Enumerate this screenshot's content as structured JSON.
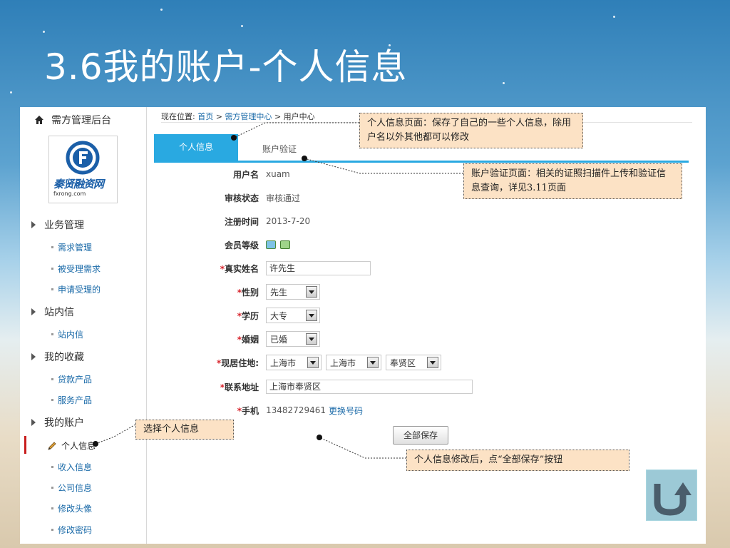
{
  "slide": {
    "title": "3.6我的账户-个人信息"
  },
  "sidebar": {
    "header": "需方管理后台",
    "logo_text": "秦贤融资网",
    "logo_subtext": "fxrong.com",
    "groups": [
      {
        "label": "业务管理",
        "items": [
          "需求管理",
          "被受理需求",
          "申请受理的"
        ]
      },
      {
        "label": "站内信",
        "items": [
          "站内信"
        ]
      },
      {
        "label": "我的收藏",
        "items": [
          "贷款产品",
          "服务产品"
        ]
      },
      {
        "label": "我的账户",
        "items": [
          "个人信息",
          "收入信息",
          "公司信息",
          "修改头像",
          "修改密码"
        ]
      }
    ],
    "active_item": "个人信息"
  },
  "breadcrumb": {
    "prefix": "现在位置:",
    "home": "首页",
    "sep1": ">",
    "center": "需方管理中心",
    "sep2": ">",
    "current": "用户中心"
  },
  "tabs": {
    "active": "个人信息",
    "inactive": "账户验证"
  },
  "form": {
    "username": {
      "label": "用户名",
      "value": "xuam"
    },
    "review_status": {
      "label": "审核状态",
      "value": "审核通过"
    },
    "register_time": {
      "label": "注册时间",
      "value": "2013-7-20"
    },
    "member_level": {
      "label": "会员等级"
    },
    "real_name": {
      "required": "*",
      "label": "真实姓名",
      "value": "许先生"
    },
    "gender": {
      "required": "*",
      "label": "性别",
      "value": "先生"
    },
    "education": {
      "required": "*",
      "label": "学历",
      "value": "大专"
    },
    "marriage": {
      "required": "*",
      "label": "婚姻",
      "value": "已婚"
    },
    "residence": {
      "required": "*",
      "label": "现居住地:",
      "province": "上海市",
      "city": "上海市",
      "district": "奉贤区"
    },
    "address": {
      "required": "*",
      "label": "联系地址",
      "value": "上海市奉贤区"
    },
    "mobile": {
      "required": "*",
      "label": "手机",
      "value": "13482729461",
      "change_link": "更换号码"
    },
    "save_label": "全部保存"
  },
  "callouts": {
    "personal_info_page": "个人信息页面：保存了自己的一些个人信息，除用户名以外其他都可以修改",
    "account_verify_page": "账户验证页面：相关的证照扫描件上传和验证信息查询，详见3.11页面",
    "select_personal_info": "选择个人信息",
    "save_hint": "个人信息修改后，点“全部保存”按钮"
  },
  "colors": {
    "tab_active": "#29a9e1",
    "link": "#1a6aa8",
    "required": "#d8242c",
    "callout_bg": "#fce2c5",
    "active_marker": "#c81e1e"
  }
}
